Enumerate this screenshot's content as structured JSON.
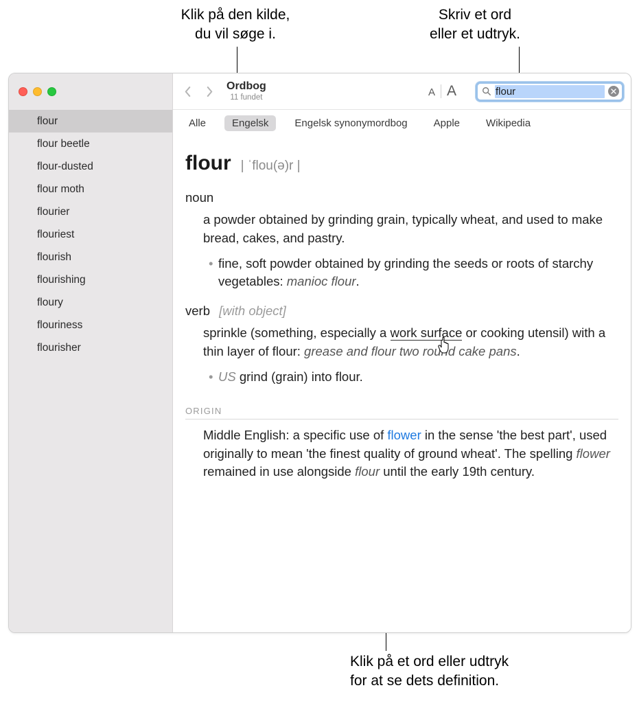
{
  "callouts": {
    "top_left": "Klik på den kilde,\ndu vil søge i.",
    "top_right": "Skriv et ord\neller et udtryk.",
    "bottom": "Klik på et ord eller udtryk\nfor at se dets definition."
  },
  "window": {
    "title": "Ordbog",
    "subtitle": "11 fundet",
    "search_value": "flour"
  },
  "sidebar": {
    "items": [
      "flour",
      "flour beetle",
      "flour-dusted",
      "flour moth",
      "flourier",
      "flouriest",
      "flourish",
      "flourishing",
      "floury",
      "flouriness",
      "flourisher"
    ]
  },
  "tabs": [
    "Alle",
    "Engelsk",
    "Engelsk synonymordbog",
    "Apple",
    "Wikipedia"
  ],
  "entry": {
    "headword": "flour",
    "pronunciation": "| ˈflou(ə)r |",
    "noun": {
      "label": "noun",
      "def": "a powder obtained by grinding grain, typically wheat, and used to make bread, cakes, and pastry.",
      "sub": "fine, soft powder obtained by grinding the seeds or roots of starchy vegetables: ",
      "sub_example": "manioc flour",
      "sub_after": "."
    },
    "verb": {
      "label": "verb",
      "qualifier": "[with object]",
      "def_pre": "sprinkle (something, especially a ",
      "def_link": "work surface",
      "def_post": " or cooking utensil) with a thin layer of flour: ",
      "def_example": "grease and flour two round cake pans",
      "def_after": ".",
      "sub_region": "US",
      "sub": " grind (grain) into flour."
    },
    "origin": {
      "heading": "ORIGIN",
      "pre": "Middle English: a specific use of ",
      "link": "flower",
      "mid": " in the sense 'the best part', used originally to mean 'the finest quality of ground wheat'. The spelling ",
      "italic": "flower",
      "mid2": " remained in use alongside ",
      "italic2": "flour",
      "post": " until the early 19th century."
    }
  }
}
